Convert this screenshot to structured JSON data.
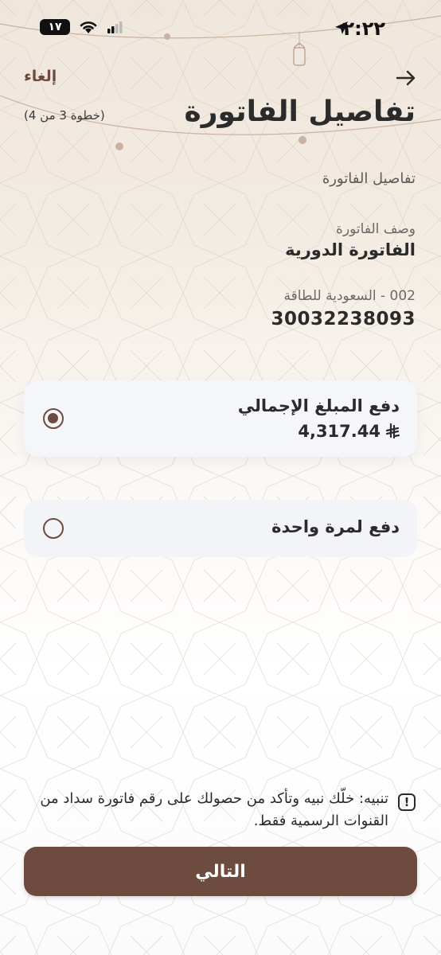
{
  "status_bar": {
    "time": "٢:٢٢",
    "battery": "١٧"
  },
  "header": {
    "cancel_label": "إلغاء",
    "title": "تفاصيل الفاتورة",
    "step": "(خطوة 3 من 4)"
  },
  "details": {
    "section_label": "تفاصيل الفاتورة",
    "description_label": "وصف الفاتورة",
    "description_value": "الفاتورة الدورية",
    "biller_label": "002 - السعودية للطاقة",
    "account_number": "30032238093"
  },
  "options": [
    {
      "label": "دفع المبلغ الإجمالي",
      "amount": "4,317.44",
      "currency_symbol": "⃁",
      "selected": true
    },
    {
      "label": "دفع لمرة واحدة",
      "selected": false
    }
  ],
  "warning": {
    "text": "تنبيه: خلّك نبيه وتأكد من حصولك على رقم فاتورة سداد من القنوات الرسمية فقط."
  },
  "next_button": {
    "label": "التالي"
  },
  "colors": {
    "accent": "#6d4b3f",
    "card_bg": "#f5f6f9",
    "text": "#2b2b2b"
  }
}
